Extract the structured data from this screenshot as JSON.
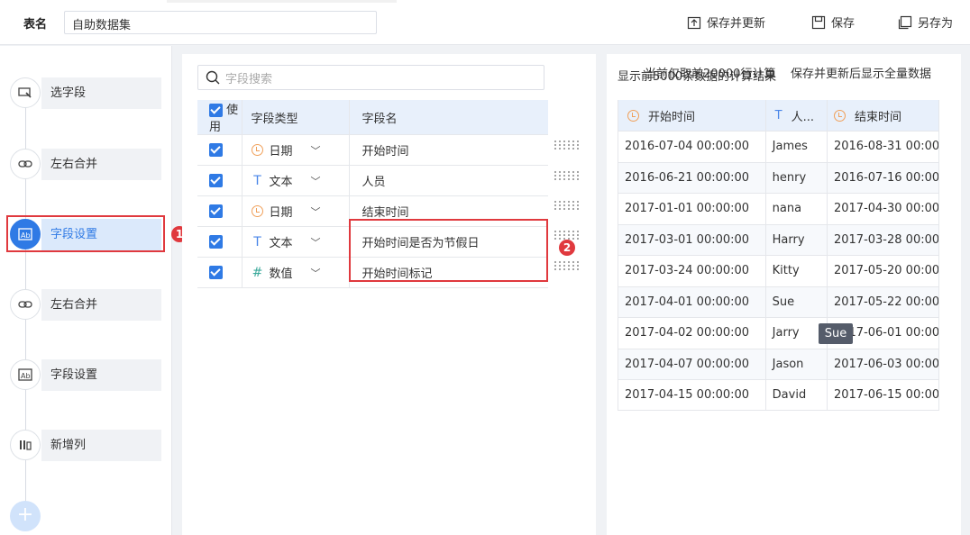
{
  "header": {
    "table_label": "表名",
    "table_name": "自助数据集",
    "save_update": "保存并更新",
    "save": "保存",
    "save_as": "另存为"
  },
  "steps": [
    {
      "label": "选字段",
      "icon": "select-field-icon"
    },
    {
      "label": "左右合并",
      "icon": "link-icon"
    },
    {
      "label": "字段设置",
      "icon": "field-settings-icon",
      "active": true
    },
    {
      "label": "左右合并",
      "icon": "link-icon"
    },
    {
      "label": "字段设置",
      "icon": "field-settings-icon"
    },
    {
      "label": "新增列",
      "icon": "add-column-icon"
    }
  ],
  "badges": {
    "one": "1",
    "two": "2"
  },
  "fields": {
    "search_placeholder": "字段搜索",
    "headers": {
      "use": "使用",
      "type": "字段类型",
      "name": "字段名"
    },
    "rows": [
      {
        "type": "日期",
        "type_icon": "clock-icon",
        "name": "开始时间"
      },
      {
        "type": "文本",
        "type_icon": "text-t-icon",
        "name": "人员"
      },
      {
        "type": "日期",
        "type_icon": "clock-icon",
        "name": "结束时间"
      },
      {
        "type": "文本",
        "type_icon": "text-t-icon",
        "name": "开始时间是否为节假日"
      },
      {
        "type": "数值",
        "type_icon": "hash-icon",
        "name": "开始时间标记"
      }
    ]
  },
  "preview": {
    "notice_a": "显示前5000条数据的计算结果",
    "notice_b": "当前仅取前20000行计算",
    "notice_c": "保存并更新后显示全量数据",
    "headers": [
      "开始时间",
      "人...",
      "结束时间"
    ],
    "rows": [
      [
        "2016-07-04 00:00:00",
        "James",
        "2016-08-31 00:00:00"
      ],
      [
        "2016-06-21 00:00:00",
        "henry",
        "2016-07-16 00:00:00"
      ],
      [
        "2017-01-01 00:00:00",
        "nana",
        "2017-04-30 00:00:00"
      ],
      [
        "2017-03-01 00:00:00",
        "Harry",
        "2017-03-28 00:00:00"
      ],
      [
        "2017-03-24 00:00:00",
        "Kitty",
        "2017-05-20 00:00:00"
      ],
      [
        "2017-04-01 00:00:00",
        "Sue",
        "2017-05-22 00:00:00"
      ],
      [
        "2017-04-02 00:00:00",
        "Jarry",
        "2017-06-01 00:00:00"
      ],
      [
        "2017-04-07 00:00:00",
        "Jason",
        "2017-06-03 00:00:00"
      ],
      [
        "2017-04-15 00:00:00",
        "David",
        "2017-06-15 00:00:00"
      ]
    ],
    "tooltip": "Sue"
  }
}
